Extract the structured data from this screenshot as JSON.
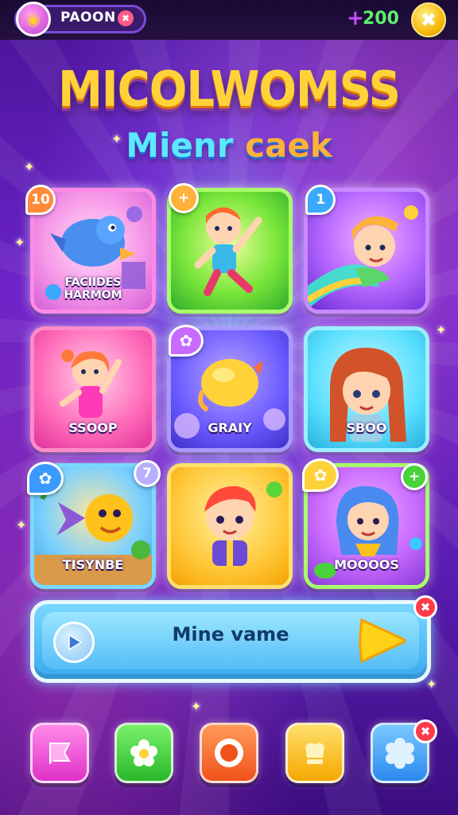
{
  "header": {
    "profile_name": "PAOON",
    "profile_badge": "✖",
    "currency_plus": "+",
    "currency_value": "200",
    "coin_symbol": "✖"
  },
  "title": "MICOLWOMSS",
  "subtitle_part1": "Mienr",
  "subtitle_part2": " caek",
  "tiles": [
    {
      "label_line1": "FACIIDES",
      "label_line2": "HARMOM",
      "badge": "10",
      "badge_color": "#ff8a3a",
      "border": "#ff6ad5"
    },
    {
      "label_line1": "",
      "label_line2": "",
      "badge": "+",
      "badge_color": "#ffb23a",
      "border": "#7ae63a"
    },
    {
      "label_line1": "",
      "label_line2": "",
      "badge": "1",
      "badge_color": "#3aa8ff",
      "border": "#b86aff"
    },
    {
      "label_line1": "SSOOP",
      "label_line2": "",
      "badge": "",
      "badge_color": "",
      "border": "#ff6ab8"
    },
    {
      "label_line1": "GRAIY",
      "label_line2": "",
      "badge": "✿",
      "badge_color": "#c86aff",
      "border": "#8a7aff"
    },
    {
      "label_line1": "SBOO",
      "label_line2": "",
      "badge": "",
      "badge_color": "",
      "border": "#5ae0ff"
    },
    {
      "label_line1": "TISYNBE",
      "label_line2": "",
      "badge": "✿",
      "badge_color": "#3a9aff",
      "badge2": "7",
      "border": "#5ac8ff"
    },
    {
      "label_line1": "",
      "label_line2": "",
      "badge": "",
      "badge_color": "",
      "border": "#ffc83a"
    },
    {
      "label_line1": "MOOOOS",
      "label_line2": "",
      "badge": "✿",
      "badge_color": "#ffd23a",
      "badge2": "+",
      "border": "#7ae63a"
    }
  ],
  "play": {
    "label": "Mine vame",
    "close": "✖"
  },
  "nav": [
    {
      "icon": "flag-icon",
      "color": "#ff4ad2"
    },
    {
      "icon": "flower-icon",
      "color": "#4ad23a"
    },
    {
      "icon": "target-icon",
      "color": "#ff6a2a"
    },
    {
      "icon": "crown-icon",
      "color": "#ffc21a"
    },
    {
      "icon": "gear-icon",
      "color": "#3aa8ff"
    }
  ],
  "nav_close": "✖"
}
